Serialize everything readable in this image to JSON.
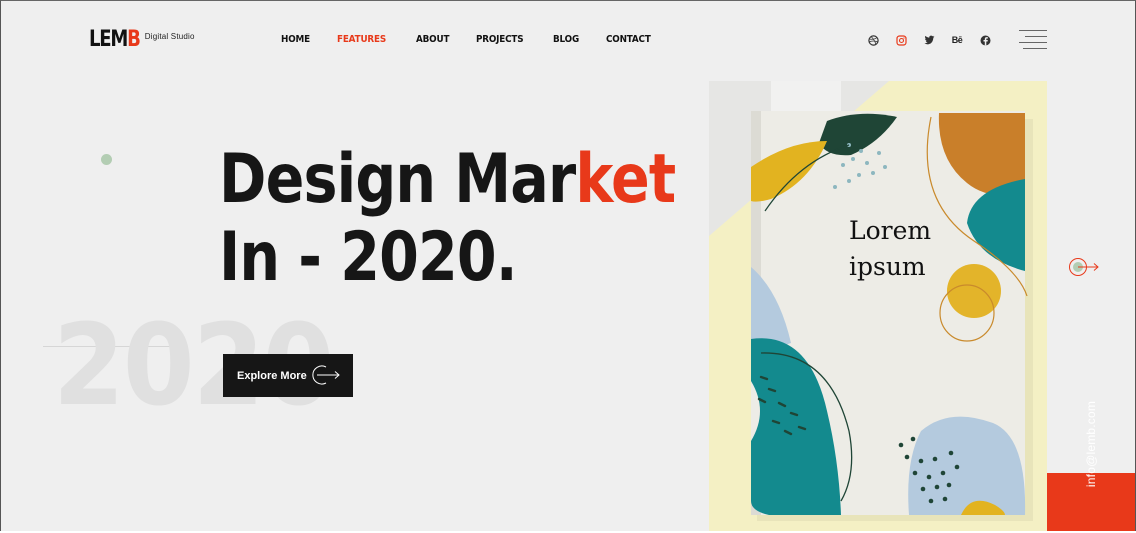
{
  "header": {
    "logo_text_main": "LEM",
    "logo_text_accent": "B",
    "logo_subtitle": "Digital Studio",
    "nav": [
      {
        "label": "HOME"
      },
      {
        "label": "FEATURES"
      },
      {
        "label": "ABOUT"
      },
      {
        "label": "PROJECTS"
      },
      {
        "label": "BLOG"
      },
      {
        "label": "CONTACT"
      }
    ],
    "active_nav": "FEATURES",
    "social_icons": [
      "dribbble-icon",
      "instagram-icon",
      "twitter-icon",
      "behance-icon",
      "facebook-icon"
    ],
    "behance_glyph": "Bē"
  },
  "hero": {
    "title_line1_prefix": "Design Mar",
    "title_line1_accent": "ket",
    "title_line2": "In - 2020.",
    "ghost_year": "2020",
    "cta_label": "Explore More"
  },
  "artwork": {
    "book_title_line1": "Lorem",
    "book_title_line2": "ipsum"
  },
  "sidebar": {
    "email": "info@lemb.com"
  },
  "colors": {
    "accent": "#e8391a",
    "dark": "#161616",
    "background": "#efefef",
    "art_yellow": "#f7f2ca"
  }
}
